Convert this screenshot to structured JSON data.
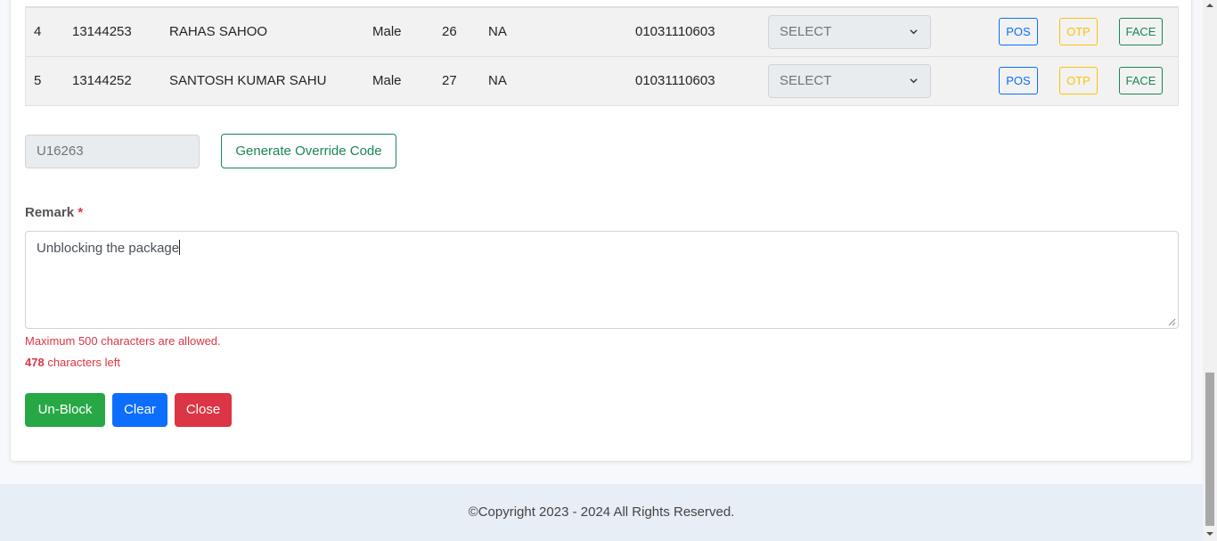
{
  "table": {
    "rows": [
      {
        "sl": "4",
        "id": "13144253",
        "name": "RAHAS SAHOO",
        "gender": "Male",
        "age": "26",
        "na": "NA",
        "number": "01031110603",
        "select": "SELECT",
        "pos": "POS",
        "otp": "OTP",
        "face": "FACE"
      },
      {
        "sl": "5",
        "id": "13144252",
        "name": "SANTOSH KUMAR SAHU",
        "gender": "Male",
        "age": "27",
        "na": "NA",
        "number": "01031110603",
        "select": "SELECT",
        "pos": "POS",
        "otp": "OTP",
        "face": "FACE"
      }
    ]
  },
  "override": {
    "value": "U16263",
    "generate_label": "Generate Override Code"
  },
  "remark": {
    "label": "Remark",
    "required_mark": "*",
    "value": "Unblocking the package",
    "max_message": "Maximum 500 characters are allowed.",
    "chars_left_count": "478",
    "chars_left_text": " characters left"
  },
  "actions": {
    "unblock": "Un-Block",
    "clear": "Clear",
    "close": "Close"
  },
  "footer": {
    "copyright": "©Copyright 2023 - 2024 All Rights Reserved."
  },
  "colors": {
    "success": "#198754",
    "primary": "#0d6efd",
    "warning": "#ffc107",
    "danger": "#dc3545"
  },
  "icons": {
    "dropdown": "chevron-down-icon",
    "resize": "resize-grip-icon"
  }
}
